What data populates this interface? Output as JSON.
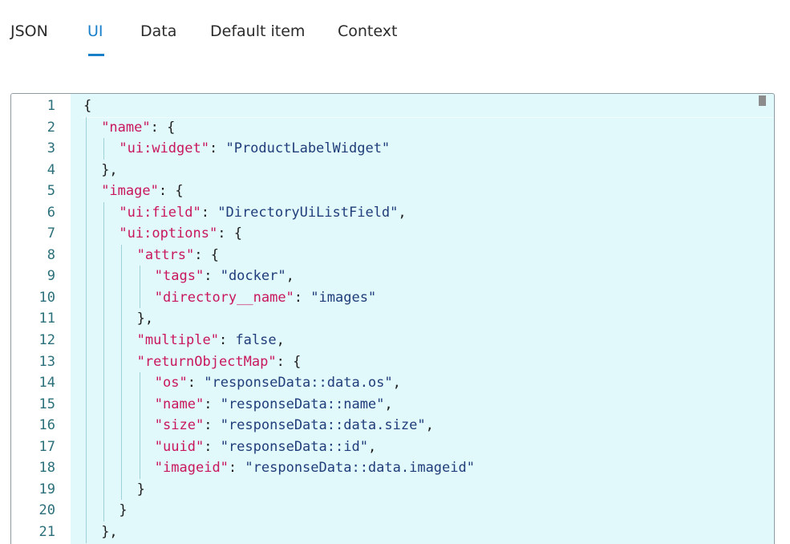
{
  "tabs": [
    {
      "label": "JSON",
      "active": false
    },
    {
      "label": "UI",
      "active": true
    },
    {
      "label": "Data",
      "active": false
    },
    {
      "label": "Default item",
      "active": false
    },
    {
      "label": "Context",
      "active": false
    }
  ],
  "colors": {
    "accent": "#1a7fc9",
    "editor_background": "#e2f9fb",
    "key": "#c8175a",
    "string": "#1f3d7a",
    "line_number": "#2a6f7a"
  },
  "editor": {
    "lines": [
      {
        "number": "1",
        "indent": 0,
        "tokens": [
          {
            "t": "p",
            "v": "{"
          }
        ]
      },
      {
        "number": "2",
        "indent": 1,
        "tokens": [
          {
            "t": "k",
            "v": "\"name\""
          },
          {
            "t": "p",
            "v": ": {"
          }
        ]
      },
      {
        "number": "3",
        "indent": 2,
        "tokens": [
          {
            "t": "k",
            "v": "\"ui:widget\""
          },
          {
            "t": "p",
            "v": ": "
          },
          {
            "t": "s",
            "v": "\"ProductLabelWidget\""
          }
        ]
      },
      {
        "number": "4",
        "indent": 1,
        "tokens": [
          {
            "t": "p",
            "v": "},"
          }
        ]
      },
      {
        "number": "5",
        "indent": 1,
        "tokens": [
          {
            "t": "k",
            "v": "\"image\""
          },
          {
            "t": "p",
            "v": ": {"
          }
        ]
      },
      {
        "number": "6",
        "indent": 2,
        "tokens": [
          {
            "t": "k",
            "v": "\"ui:field\""
          },
          {
            "t": "p",
            "v": ": "
          },
          {
            "t": "s",
            "v": "\"DirectoryUiListField\""
          },
          {
            "t": "p",
            "v": ","
          }
        ]
      },
      {
        "number": "7",
        "indent": 2,
        "tokens": [
          {
            "t": "k",
            "v": "\"ui:options\""
          },
          {
            "t": "p",
            "v": ": {"
          }
        ]
      },
      {
        "number": "8",
        "indent": 3,
        "tokens": [
          {
            "t": "k",
            "v": "\"attrs\""
          },
          {
            "t": "p",
            "v": ": {"
          }
        ]
      },
      {
        "number": "9",
        "indent": 4,
        "tokens": [
          {
            "t": "k",
            "v": "\"tags\""
          },
          {
            "t": "p",
            "v": ": "
          },
          {
            "t": "s",
            "v": "\"docker\""
          },
          {
            "t": "p",
            "v": ","
          }
        ]
      },
      {
        "number": "10",
        "indent": 4,
        "tokens": [
          {
            "t": "k",
            "v": "\"directory__name\""
          },
          {
            "t": "p",
            "v": ": "
          },
          {
            "t": "s",
            "v": "\"images\""
          }
        ]
      },
      {
        "number": "11",
        "indent": 3,
        "tokens": [
          {
            "t": "p",
            "v": "},"
          }
        ]
      },
      {
        "number": "12",
        "indent": 3,
        "tokens": [
          {
            "t": "k",
            "v": "\"multiple\""
          },
          {
            "t": "p",
            "v": ": "
          },
          {
            "t": "b",
            "v": "false"
          },
          {
            "t": "p",
            "v": ","
          }
        ]
      },
      {
        "number": "13",
        "indent": 3,
        "tokens": [
          {
            "t": "k",
            "v": "\"returnObjectMap\""
          },
          {
            "t": "p",
            "v": ": {"
          }
        ]
      },
      {
        "number": "14",
        "indent": 4,
        "tokens": [
          {
            "t": "k",
            "v": "\"os\""
          },
          {
            "t": "p",
            "v": ": "
          },
          {
            "t": "s",
            "v": "\"responseData::data.os\""
          },
          {
            "t": "p",
            "v": ","
          }
        ]
      },
      {
        "number": "15",
        "indent": 4,
        "tokens": [
          {
            "t": "k",
            "v": "\"name\""
          },
          {
            "t": "p",
            "v": ": "
          },
          {
            "t": "s",
            "v": "\"responseData::name\""
          },
          {
            "t": "p",
            "v": ","
          }
        ]
      },
      {
        "number": "16",
        "indent": 4,
        "tokens": [
          {
            "t": "k",
            "v": "\"size\""
          },
          {
            "t": "p",
            "v": ": "
          },
          {
            "t": "s",
            "v": "\"responseData::data.size\""
          },
          {
            "t": "p",
            "v": ","
          }
        ]
      },
      {
        "number": "17",
        "indent": 4,
        "tokens": [
          {
            "t": "k",
            "v": "\"uuid\""
          },
          {
            "t": "p",
            "v": ": "
          },
          {
            "t": "s",
            "v": "\"responseData::id\""
          },
          {
            "t": "p",
            "v": ","
          }
        ]
      },
      {
        "number": "18",
        "indent": 4,
        "tokens": [
          {
            "t": "k",
            "v": "\"imageid\""
          },
          {
            "t": "p",
            "v": ": "
          },
          {
            "t": "s",
            "v": "\"responseData::data.imageid\""
          }
        ]
      },
      {
        "number": "19",
        "indent": 3,
        "tokens": [
          {
            "t": "p",
            "v": "}"
          }
        ]
      },
      {
        "number": "20",
        "indent": 2,
        "tokens": [
          {
            "t": "p",
            "v": "}"
          }
        ]
      },
      {
        "number": "21",
        "indent": 1,
        "tokens": [
          {
            "t": "p",
            "v": "},"
          }
        ]
      }
    ]
  }
}
